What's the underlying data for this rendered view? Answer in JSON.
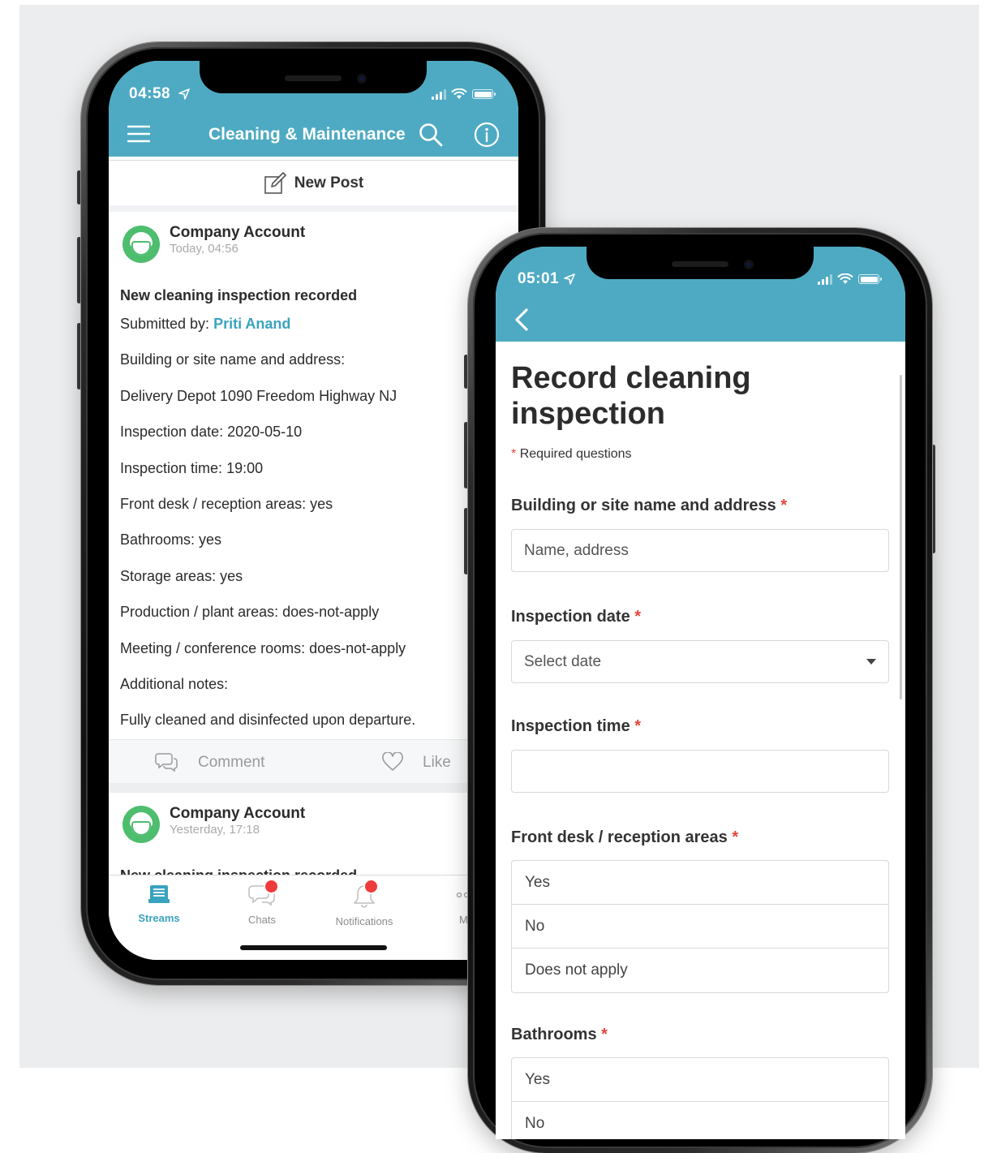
{
  "left_phone": {
    "status_time": "04:58",
    "nav_title": "Cleaning & Maintenance",
    "new_post_label": "New Post",
    "post1": {
      "author": "Company Account",
      "time": "Today, 04:56",
      "title": "New cleaning inspection recorded",
      "submitted_prefix": "Submitted by:",
      "submitted_name": "Priti Anand",
      "lines": [
        "Building or site name and address:",
        "Delivery Depot 1090 Freedom Highway NJ",
        "Inspection date: 2020-05-10",
        "Inspection time: 19:00",
        "Front desk / reception areas: yes",
        "Bathrooms: yes",
        "Storage areas: yes",
        "Production / plant areas: does-not-apply",
        "Meeting / conference rooms: does-not-apply",
        "Additional notes:",
        "Fully cleaned and disinfected upon departure."
      ],
      "comment_label": "Comment",
      "like_label": "Like"
    },
    "post2": {
      "author": "Company Account",
      "time": "Yesterday, 17:18",
      "title_partial": "New cleaning inspection recorded"
    },
    "tabs": [
      {
        "label": "Streams",
        "active": true
      },
      {
        "label": "Chats",
        "badge": true
      },
      {
        "label": "Notifications",
        "badge": true
      },
      {
        "label": "Mo"
      }
    ]
  },
  "right_phone": {
    "status_time": "05:01",
    "form_title_line1": "Record cleaning",
    "form_title_line2": "inspection",
    "required_note": "Required questions",
    "required_star": "*",
    "q_building": "Building or site name and address",
    "building_placeholder": "Name, address",
    "q_date": "Inspection date",
    "date_value": "Select date",
    "q_time": "Inspection time",
    "time_value": "",
    "q_front_desk": "Front desk / reception areas",
    "front_desk_options": [
      "Yes",
      "No",
      "Does not apply"
    ],
    "q_bathrooms": "Bathrooms",
    "bathrooms_options": [
      "Yes",
      "No"
    ]
  },
  "colors": {
    "brand": "#4eaac3",
    "link": "#3aa3be",
    "required": "#e4463a",
    "avatar": "#4dbd6e",
    "badge": "#ef3b3b"
  }
}
